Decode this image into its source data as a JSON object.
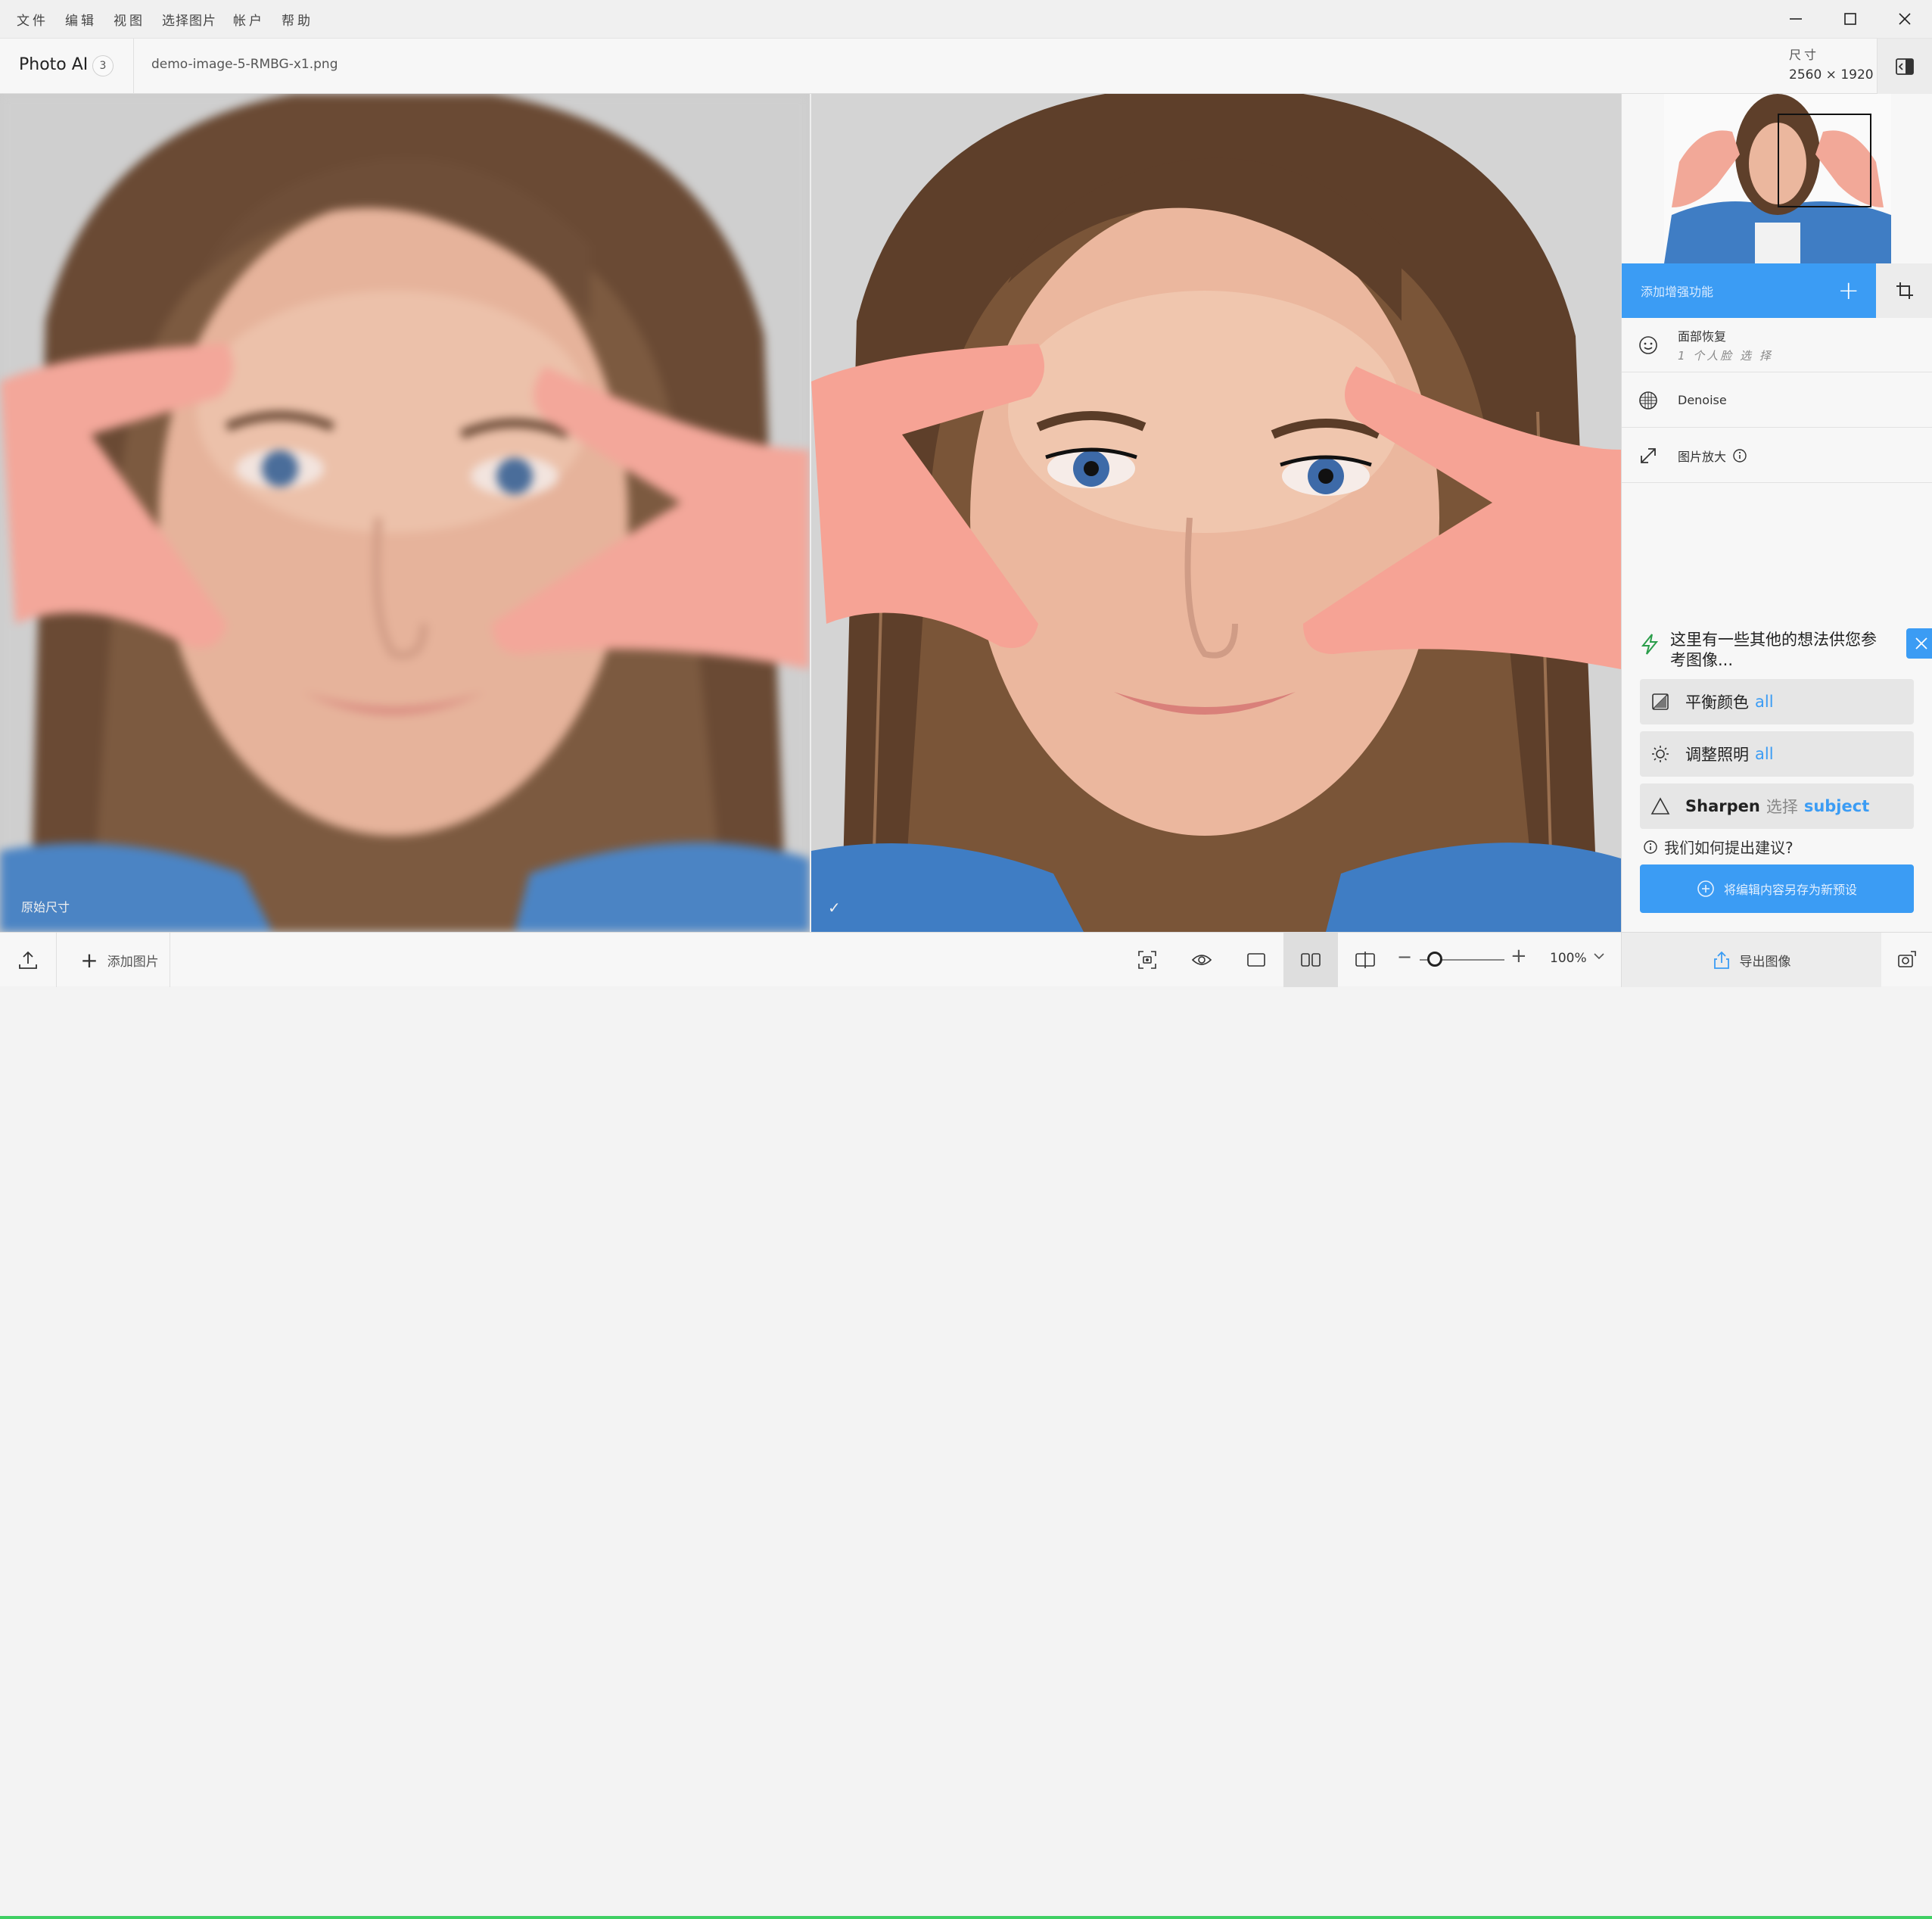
{
  "menu": [
    "文件",
    "编辑",
    "视图",
    "选择图片",
    "帐户",
    "帮助"
  ],
  "header": {
    "app_name": "Photo AI",
    "badge": "3",
    "filename": "demo-image-5-RMBG-x1.png",
    "size_label": "尺寸",
    "size_value": "2560 × 1920"
  },
  "viewer": {
    "original_label": "原始尺寸",
    "check": "✓"
  },
  "panel": {
    "add_enhancement": "添加增强功能",
    "features": [
      {
        "title": "面部恢复",
        "subtitle": "1 个人脸 选 择",
        "icon": "face-icon"
      },
      {
        "title": "Denoise",
        "subtitle": "",
        "icon": "denoise-icon"
      },
      {
        "title": "图片放大",
        "subtitle": "",
        "icon": "upscale-icon"
      }
    ],
    "ideas_title": "这里有一些其他的想法供您参考图像...",
    "suggestions": [
      {
        "label": "平衡颜色",
        "mid": "",
        "accent": "all",
        "icon": "balance-color-icon"
      },
      {
        "label": "调整照明",
        "mid": "",
        "accent": "all",
        "icon": "lighting-icon"
      },
      {
        "label": "Sharpen",
        "mid": "选择",
        "accent": "subject",
        "icon": "sharpen-icon"
      }
    ],
    "how_suggest": "我们如何提出建议?",
    "save_preset": "将编辑内容另存为新预设"
  },
  "bottom": {
    "add_image": "添加图片",
    "zoom": "100%",
    "zoom_fraction": 0.18,
    "export": "导出图像"
  },
  "colors": {
    "accent": "#3b9cf4",
    "panel_bg": "#f7f7f7"
  }
}
